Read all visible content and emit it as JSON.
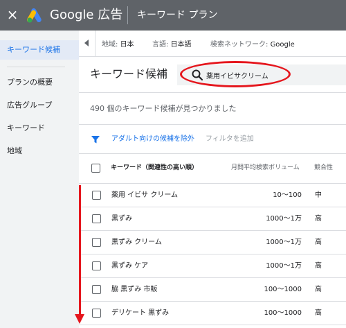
{
  "topbar": {
    "close_glyph": "×",
    "brand": "Google 広告",
    "page_title": "キーワード プラン"
  },
  "sidebar": {
    "active": "キーワード候補",
    "items": [
      "プランの概要",
      "広告グループ",
      "キーワード",
      "地域"
    ]
  },
  "infobar": {
    "location_label": "地域:",
    "location_value": "日本",
    "language_label": "言語:",
    "language_value": "日本語",
    "network_label": "検索ネットワーク:",
    "network_value": "Google"
  },
  "main": {
    "title": "キーワード候補",
    "search_value": "薬用イビサクリーム",
    "count_text": "490 個のキーワード候補が見つかりました",
    "filter_exclude": "アダルト向けの候補を除外",
    "filter_add": "フィルタを追加"
  },
  "table": {
    "headers": {
      "keyword": "キーワード（関連性の高い順）",
      "volume": "月間平均検索ボリューム",
      "competition": "競合性"
    },
    "rows": [
      {
        "keyword": "薬用 イビサ クリーム",
        "volume": "10～100",
        "competition": "中"
      },
      {
        "keyword": "黒ずみ",
        "volume": "1000～1万",
        "competition": "高"
      },
      {
        "keyword": "黒ずみ クリーム",
        "volume": "1000～1万",
        "competition": "高"
      },
      {
        "keyword": "黒ずみ ケア",
        "volume": "1000～1万",
        "competition": "高"
      },
      {
        "keyword": "脇 黒ずみ 市販",
        "volume": "100～1000",
        "competition": "高"
      },
      {
        "keyword": "デリケート 黒ずみ",
        "volume": "100～1000",
        "competition": "高"
      }
    ]
  },
  "colors": {
    "topbar": "#5f6368",
    "accent": "#1a73e8",
    "annotation": "#e5161d"
  }
}
